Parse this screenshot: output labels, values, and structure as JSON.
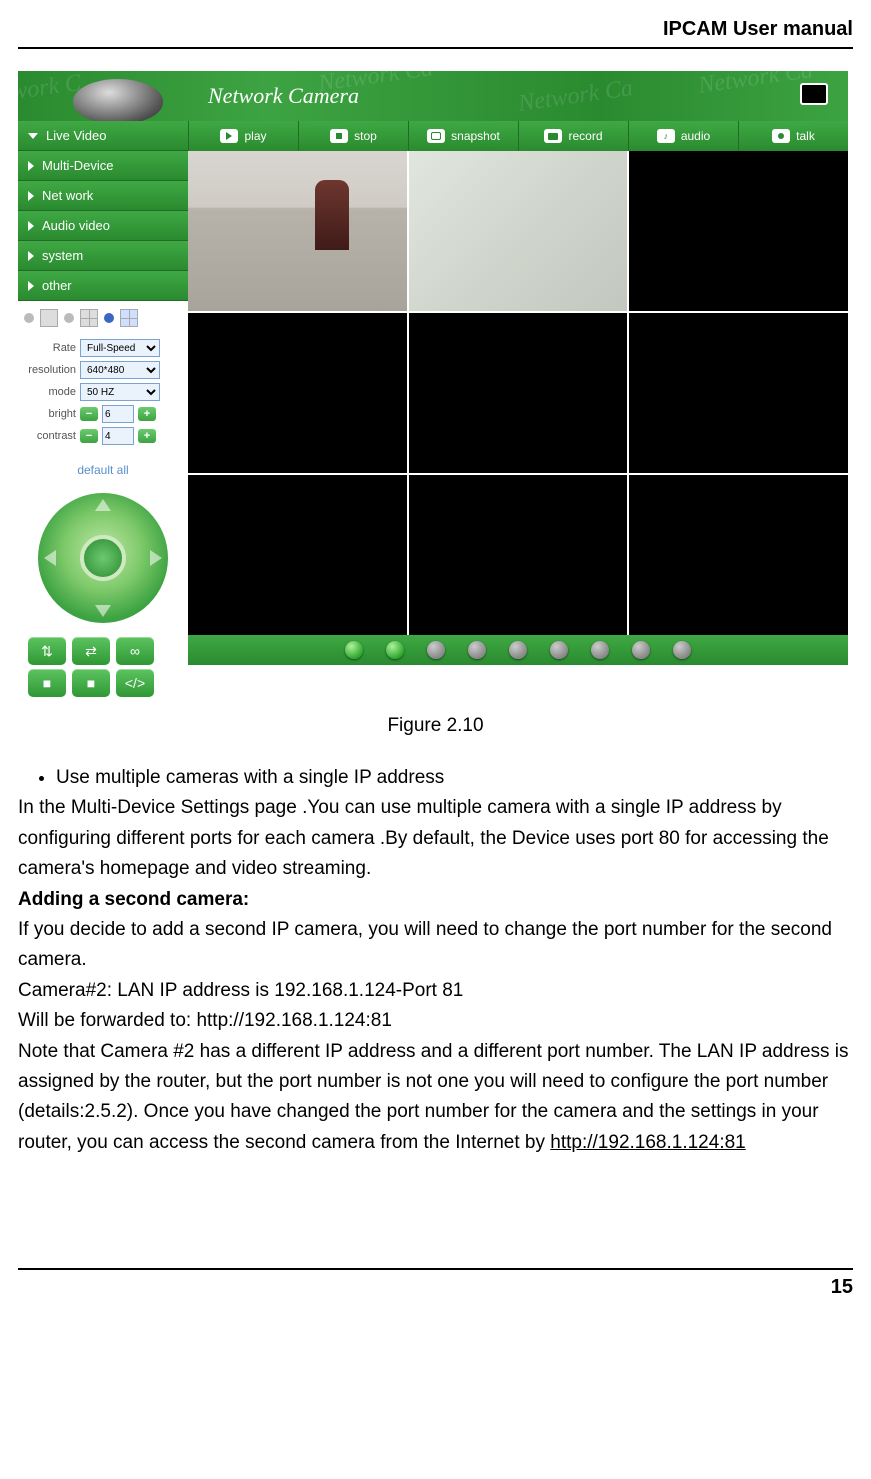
{
  "header": {
    "title": "IPCAM User manual"
  },
  "app": {
    "banner_title": "Network Camera",
    "sidebar": {
      "items": [
        {
          "label": "Live Video",
          "expanded": true
        },
        {
          "label": "Multi-Device",
          "expanded": false
        },
        {
          "label": "Net work",
          "expanded": false
        },
        {
          "label": "Audio video",
          "expanded": false
        },
        {
          "label": "system",
          "expanded": false
        },
        {
          "label": "other",
          "expanded": false
        }
      ],
      "settings": {
        "rate_label": "Rate",
        "rate_value": "Full-Speed",
        "resolution_label": "resolution",
        "resolution_value": "640*480",
        "mode_label": "mode",
        "mode_value": "50 HZ",
        "bright_label": "bright",
        "bright_value": "6",
        "contrast_label": "contrast",
        "contrast_value": "4",
        "default_label": "default all"
      }
    },
    "toolbar": {
      "play": "play",
      "stop": "stop",
      "snapshot": "snapshot",
      "record": "record",
      "audio": "audio",
      "talk": "talk"
    },
    "indicators": {
      "count": 9,
      "active": [
        0,
        1
      ]
    }
  },
  "caption": "Figure 2.10",
  "body": {
    "bullet1": "Use multiple cameras with a single IP address",
    "p1": "In the Multi-Device Settings page .You can use multiple camera with a single IP address by configuring different ports for each camera .By default, the Device uses port 80 for accessing the camera's homepage and video streaming.",
    "h1": "Adding a second camera:",
    "p2": "If you decide to add a second IP camera, you will need to change the port number for the second camera.",
    "p3": "Camera#2: LAN IP address is 192.168.1.124-Port 81",
    "p4": "Will be forwarded to: http://192.168.1.124:81",
    "p5a": "Note that Camera #2 has a different IP address and a different port number. The LAN IP address is assigned by the router, but the port number is not one you will need to configure the port number (details:2.5.2). Once you have changed the port number for the camera and the settings in your router, you can access the second camera from the Internet by ",
    "p5_link": "http://192.168.1.124:81"
  },
  "footer": {
    "page": "15"
  }
}
